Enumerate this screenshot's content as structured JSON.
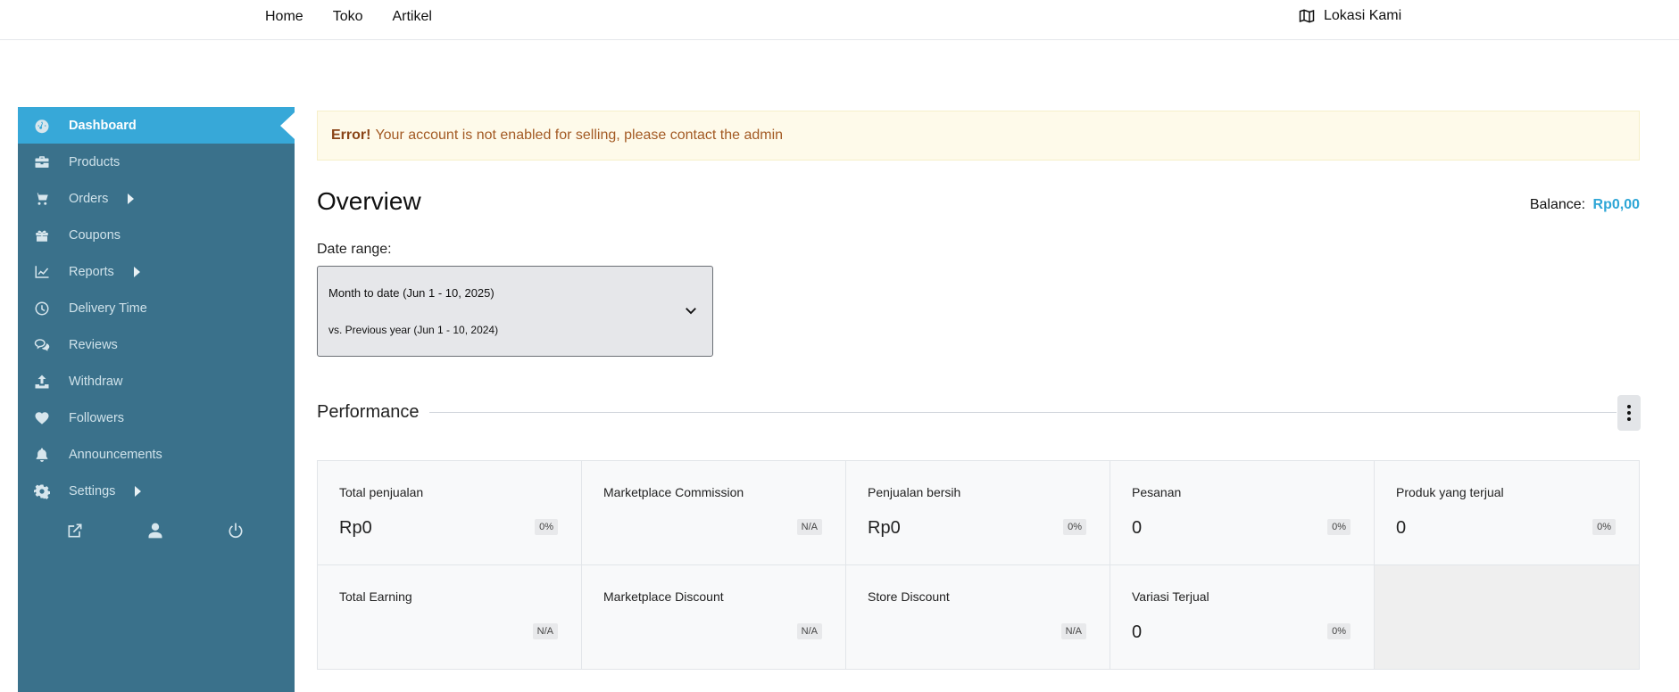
{
  "topnav": {
    "items": [
      "Home",
      "Toko",
      "Artikel"
    ],
    "location_label": "Lokasi Kami"
  },
  "sidebar": {
    "items": [
      {
        "label": "Dashboard",
        "icon": "dashboard-icon",
        "active": true
      },
      {
        "label": "Products",
        "icon": "briefcase-icon"
      },
      {
        "label": "Orders",
        "icon": "cart-icon",
        "submenu": true
      },
      {
        "label": "Coupons",
        "icon": "gift-icon"
      },
      {
        "label": "Reports",
        "icon": "chart-line-icon",
        "submenu": true
      },
      {
        "label": "Delivery Time",
        "icon": "clock-icon"
      },
      {
        "label": "Reviews",
        "icon": "comments-icon"
      },
      {
        "label": "Withdraw",
        "icon": "upload-icon"
      },
      {
        "label": "Followers",
        "icon": "heart-icon"
      },
      {
        "label": "Announcements",
        "icon": "bell-icon"
      },
      {
        "label": "Settings",
        "icon": "gear-icon",
        "submenu": true
      }
    ],
    "tools": [
      "external-link-icon",
      "user-icon",
      "power-icon"
    ]
  },
  "alert": {
    "strong": "Error!",
    "text": "Your account is not enabled for selling, please contact the admin"
  },
  "overview": {
    "title": "Overview",
    "balance_label": "Balance:",
    "balance_value": "Rp0,00"
  },
  "daterange": {
    "label": "Date range:",
    "primary": "Month to date (Jun 1 - 10, 2025)",
    "compare": "vs. Previous year (Jun 1 - 10, 2024)"
  },
  "performance": {
    "title": "Performance",
    "cards": [
      {
        "label": "Total penjualan",
        "value": "Rp0",
        "delta": "0%"
      },
      {
        "label": "Marketplace Commission",
        "value": "",
        "delta": "N/A"
      },
      {
        "label": "Penjualan bersih",
        "value": "Rp0",
        "delta": "0%"
      },
      {
        "label": "Pesanan",
        "value": "0",
        "delta": "0%"
      },
      {
        "label": "Produk yang terjual",
        "value": "0",
        "delta": "0%"
      },
      {
        "label": "Total Earning",
        "value": "",
        "delta": "N/A"
      },
      {
        "label": "Marketplace Discount",
        "value": "",
        "delta": "N/A"
      },
      {
        "label": "Store Discount",
        "value": "",
        "delta": "N/A"
      },
      {
        "label": "Variasi Terjual",
        "value": "0",
        "delta": "0%"
      }
    ]
  },
  "colors": {
    "sidebar": "#3a718b",
    "active": "#37a8d8",
    "accent": "#2ea6d6",
    "alert_bg": "#fefaea",
    "alert_text": "#a35a24"
  }
}
